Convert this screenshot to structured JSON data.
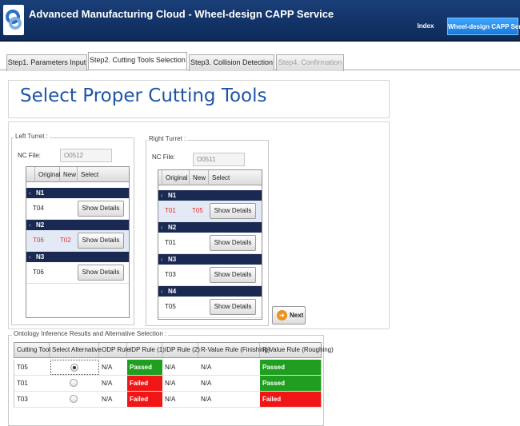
{
  "header": {
    "title": "Advanced Manufacturing Cloud - Wheel-design CAPP Service",
    "nav": {
      "index": "Index",
      "service": "Wheel-design CAPP Service"
    }
  },
  "tabs": [
    {
      "label": "Step1. Parameters Input",
      "state": "normal"
    },
    {
      "label": "Step2. Cutting Tools Selection",
      "state": "active"
    },
    {
      "label": "Step3. Collision Detection",
      "state": "normal"
    },
    {
      "label": "Step4. Confirmation",
      "state": "disabled"
    }
  ],
  "page_title": "Select Proper Cutting Tools",
  "left_turret": {
    "label": "Left Turret :",
    "nc_label": "NC File:",
    "nc_value": "O0512",
    "columns": [
      "Original",
      "New",
      "Select"
    ],
    "groups": [
      {
        "name": "N1",
        "original": "T04",
        "new": "",
        "button": "Show Details",
        "highlight": false
      },
      {
        "name": "N2",
        "original": "T06",
        "new": "T02",
        "button": "Show Details",
        "highlight": true
      },
      {
        "name": "N3",
        "original": "T06",
        "new": "",
        "button": "Show Details",
        "highlight": false
      }
    ]
  },
  "right_turret": {
    "label": "Right Turret :",
    "nc_label": "NC File:",
    "nc_value": "O0511",
    "columns": [
      "Original",
      "New",
      "Select"
    ],
    "groups": [
      {
        "name": "N1",
        "original": "T01",
        "new": "T05",
        "button": "Show Details",
        "highlight": true
      },
      {
        "name": "N2",
        "original": "T01",
        "new": "",
        "button": "Show Details",
        "highlight": false
      },
      {
        "name": "N3",
        "original": "T03",
        "new": "",
        "button": "Show Details",
        "highlight": false
      },
      {
        "name": "N4",
        "original": "T05",
        "new": "",
        "button": "Show Details",
        "highlight": false
      }
    ]
  },
  "next_button": "Next",
  "ontology": {
    "label": "Ontology Inference Results and Alternative Selection :",
    "columns": [
      "Cutting Tool",
      "Select Alternative",
      "ODP Rule",
      "IDP Rule (1)",
      "IDP Rule (2)",
      "R-Value Rule (Finishing)",
      "R-Value Rule (Roughing)"
    ],
    "rows": [
      {
        "tool": "T05",
        "selected": true,
        "odp": "N/A",
        "idp1": "Passed",
        "idp2": "N/A",
        "rv_fin": "N/A",
        "rv_rough": "Passed"
      },
      {
        "tool": "T01",
        "selected": false,
        "odp": "N/A",
        "idp1": "Failed",
        "idp2": "N/A",
        "rv_fin": "N/A",
        "rv_rough": "Passed"
      },
      {
        "tool": "T03",
        "selected": false,
        "odp": "N/A",
        "idp1": "Failed",
        "idp2": "N/A",
        "rv_fin": "N/A",
        "rv_rough": "Failed"
      }
    ]
  },
  "colors": {
    "header_bg": "#1a3f78",
    "title_blue": "#1e55a7",
    "passed": "#1f9e1f",
    "failed": "#f01616",
    "group_row": "#1a2952",
    "accent_red_text": "#e0312a"
  }
}
